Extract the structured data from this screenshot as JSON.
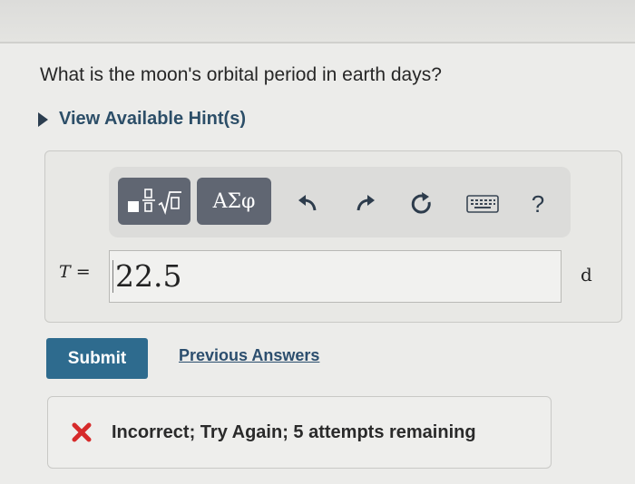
{
  "question": "What is the moon's orbital period in earth days?",
  "hints": {
    "label": "View Available Hint(s)"
  },
  "toolbar": {
    "templates_icon": "templates-icon",
    "symbols_label": "ΑΣφ",
    "undo_icon": "undo-icon",
    "redo_icon": "redo-icon",
    "reset_icon": "reset-icon",
    "keyboard_icon": "keyboard-icon",
    "help_label": "?"
  },
  "answer": {
    "variable": "T",
    "equals": "=",
    "value": "22.5",
    "unit": "d"
  },
  "actions": {
    "submit_label": "Submit",
    "previous_answers_label": "Previous Answers"
  },
  "feedback": {
    "icon": "x-icon",
    "text": "Incorrect; Try Again; 5 attempts remaining",
    "color": "#d62a2a"
  },
  "colors": {
    "submit_bg": "#2e6b8e",
    "toolbar_button_bg": "#606672",
    "link": "#2c4e6e"
  }
}
